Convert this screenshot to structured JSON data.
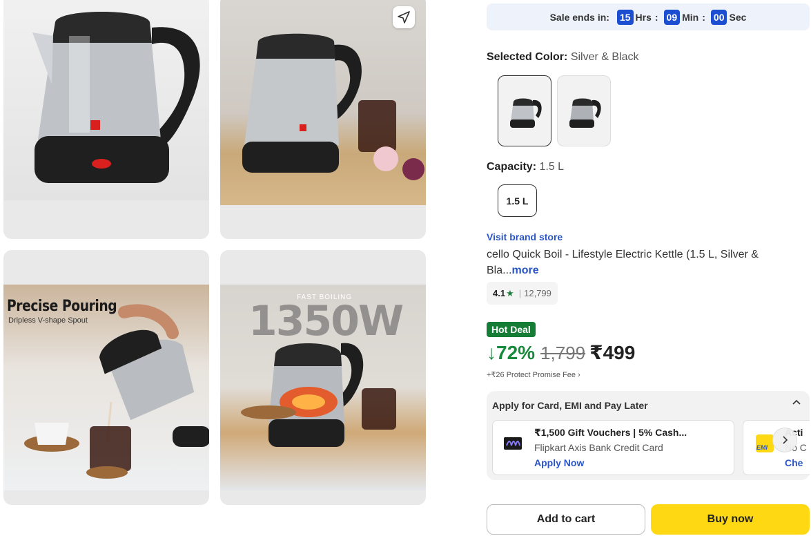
{
  "gallery": {
    "images": [
      {
        "name": "kettle-front-view"
      },
      {
        "name": "kettle-lifestyle-view"
      },
      {
        "name": "kettle-pouring-view",
        "overlay_title": "Precise Pouring",
        "overlay_sub": "Dripless V-shape Spout"
      },
      {
        "name": "kettle-boiling-view",
        "overlay_tag": "FAST BOILING",
        "overlay_big": "1350W"
      }
    ]
  },
  "sale": {
    "label": "Sale ends in:",
    "hours": "15",
    "hours_unit": "Hrs",
    "minutes": "09",
    "minutes_unit": "Min",
    "seconds": "00",
    "seconds_unit": "Sec"
  },
  "color": {
    "label": "Selected Color:",
    "value": "Silver & Black"
  },
  "capacity": {
    "label": "Capacity:",
    "value": "1.5 L",
    "option": "1.5 L"
  },
  "product": {
    "brand_link": "Visit brand store",
    "title": "cello Quick Boil - Lifestyle Electric Kettle (1.5 L, Silver & Bla...",
    "more": "more",
    "rating": "4.1",
    "rating_count": "12,799",
    "deal_badge": "Hot Deal",
    "discount": "↓72%",
    "mrp": "1,799",
    "price": "₹499",
    "fee": "+₹26 Protect Promise Fee"
  },
  "emi": {
    "heading": "Apply for Card, EMI and Pay Later",
    "offers": [
      {
        "title": "₹1,500 Gift Vouchers | 5% Cash...",
        "subtitle": "Flipkart Axis Bank Credit Card",
        "cta": "Apply Now"
      },
      {
        "title": "Acti",
        "subtitle": "No C",
        "cta": "Che",
        "logo_text": "EMI"
      }
    ]
  },
  "actions": {
    "add_to_cart": "Add to cart",
    "buy_now": "Buy now"
  },
  "colors": {
    "accent_blue": "#1b4ed1",
    "link_blue": "#2a55c5",
    "deal_green": "#167d37",
    "buy_yellow": "#ffd814"
  }
}
